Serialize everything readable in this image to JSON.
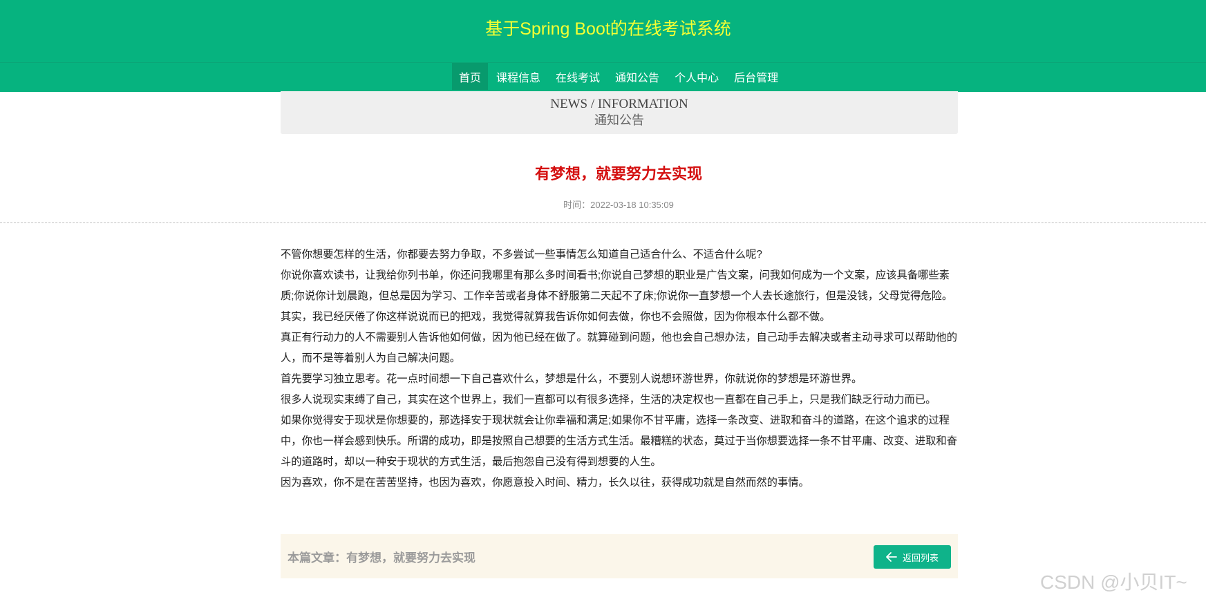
{
  "site": {
    "title": "基于Spring Boot的在线考试系统"
  },
  "nav": {
    "items": [
      {
        "label": "首页"
      },
      {
        "label": "课程信息"
      },
      {
        "label": "在线考试"
      },
      {
        "label": "通知公告"
      },
      {
        "label": "个人中心"
      },
      {
        "label": "后台管理"
      }
    ],
    "active": "首页"
  },
  "section": {
    "en": "NEWS / INFORMATION",
    "cn": "通知公告"
  },
  "article": {
    "title": "有梦想，就要努力去实现",
    "time_label": "时间：",
    "time": "2022-03-18 10:35:09",
    "paragraphs": [
      "不管你想要怎样的生活，你都要去努力争取，不多尝试一些事情怎么知道自己适合什么、不适合什么呢?",
      "你说你喜欢读书，让我给你列书单，你还问我哪里有那么多时间看书;你说自己梦想的职业是广告文案，问我如何成为一个文案，应该具备哪些素质;你说你计划晨跑，但总是因为学习、工作辛苦或者身体不舒服第二天起不了床;你说你一直梦想一个人去长途旅行，但是没钱，父母觉得危险。其实，我已经厌倦了你这样说说而已的把戏，我觉得就算我告诉你如何去做，你也不会照做，因为你根本什么都不做。",
      "真正有行动力的人不需要别人告诉他如何做，因为他已经在做了。就算碰到问题，他也会自己想办法，自己动手去解决或者主动寻求可以帮助他的人，而不是等着别人为自己解决问题。",
      "首先要学习独立思考。花一点时间想一下自己喜欢什么，梦想是什么，不要别人说想环游世界，你就说你的梦想是环游世界。",
      "很多人说现实束缚了自己，其实在这个世界上，我们一直都可以有很多选择，生活的决定权也一直都在自己手上，只是我们缺乏行动力而已。",
      "如果你觉得安于现状是你想要的，那选择安于现状就会让你幸福和满足;如果你不甘平庸，选择一条改变、进取和奋斗的道路，在这个追求的过程中，你也一样会感到快乐。所谓的成功，即是按照自己想要的生活方式生活。最糟糕的状态，莫过于当你想要选择一条不甘平庸、改变、进取和奋斗的道路时，却以一种安于现状的方式生活，最后抱怨自己没有得到想要的人生。",
      "因为喜欢，你不是在苦苦坚持，也因为喜欢，你愿意投入时间、精力，长久以往，获得成功就是自然而然的事情。"
    ]
  },
  "footer": {
    "current_label": "本篇文章：有梦想，就要努力去实现",
    "back_label": "返回列表"
  },
  "watermark": "CSDN @小贝IT~",
  "colors": {
    "header_bg": "#06b37f",
    "title_color": "#f5ff33",
    "nav_active_bg": "#089a6d",
    "article_title_color": "#d40f0f",
    "button_bg": "#0fb38a"
  }
}
